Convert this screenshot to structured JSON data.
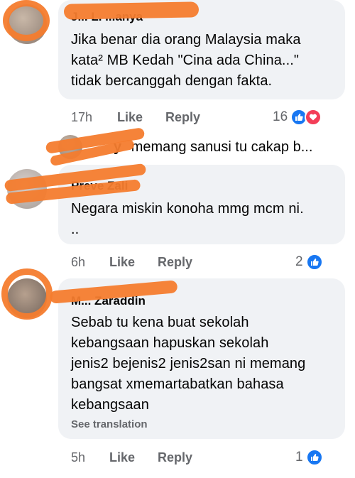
{
  "comments": [
    {
      "author": "J... L. ...anya",
      "text_lines": [
        "Jika benar dia orang Malaysia maka",
        "kata² MB Kedah \"Cina ada China...\"",
        "tidak bercanggah dengan fakta."
      ],
      "time": "17h",
      "like_label": "Like",
      "reply_label": "Reply",
      "reaction_count": "16"
    },
    {
      "author": "Preve Zali",
      "text_lines": [
        "Negara miskin konoha mmg mcm ni.",
        ".."
      ],
      "time": "6h",
      "like_label": "Like",
      "reply_label": "Reply",
      "reaction_count": "2"
    },
    {
      "author": "M... Zaraddin",
      "text_lines": [
        "Sebab tu kena buat sekolah",
        "kebangsaan hapuskan sekolah",
        "jenis2 bejenis2 jenis2san ni memang",
        "bangsat xmemartabatkan bahasa",
        "kebangsaan"
      ],
      "see_translation": "See translation",
      "time": "5h",
      "like_label": "Like",
      "reply_label": "Reply",
      "reaction_count": "1"
    }
  ],
  "reply_preview": {
    "author_suffix": "y",
    "text": "memang sanusi tu cakap b..."
  },
  "colors": {
    "bubble": "#f0f2f5",
    "meta_text": "#65676b",
    "like_blue": "#1877f2",
    "love_red": "#f33e58",
    "redaction_orange": "#f47c2e"
  }
}
